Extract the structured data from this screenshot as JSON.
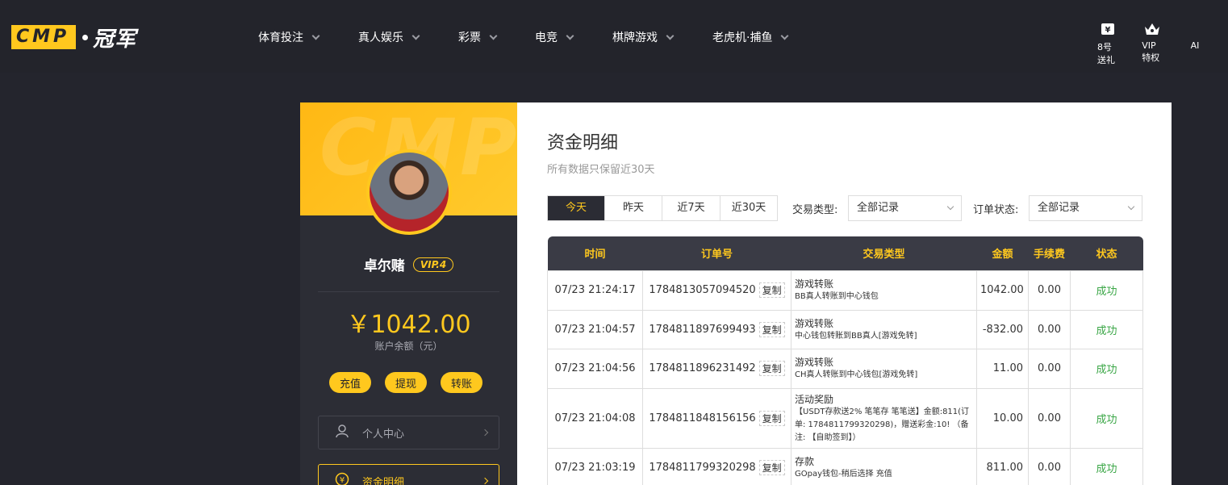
{
  "brand": {
    "logo_text": "CMP",
    "logo_cn": "冠军"
  },
  "nav": [
    {
      "label": "体育投注"
    },
    {
      "label": "真人娱乐"
    },
    {
      "label": "彩票"
    },
    {
      "label": "电竞"
    },
    {
      "label": "棋牌游戏"
    },
    {
      "label": "老虎机·捕鱼"
    }
  ],
  "top_right": [
    {
      "label": "8号送礼",
      "icon": "gift-ticket-icon"
    },
    {
      "label": "VIP特权",
      "icon": "crown-icon"
    },
    {
      "label": "AI",
      "icon": "app-icon"
    }
  ],
  "profile": {
    "header_watermark": "CMP",
    "username": "卓尔赌",
    "vip": "VIP.4",
    "balance": "￥1042.00",
    "balance_label": "账户余额（元）",
    "actions": [
      "充值",
      "提现",
      "转账"
    ],
    "menu": [
      {
        "label": "个人中心",
        "icon": "user-icon",
        "active": false
      },
      {
        "label": "资金明细",
        "icon": "coin-icon",
        "active": true
      }
    ]
  },
  "panel": {
    "title": "资金明细",
    "subtitle": "所有数据只保留近30天",
    "ranges": [
      "今天",
      "昨天",
      "近7天",
      "近30天"
    ],
    "active_range": 0,
    "filter_type_label": "交易类型:",
    "filter_type_value": "全部记录",
    "filter_status_label": "订单状态:",
    "filter_status_value": "全部记录"
  },
  "table": {
    "headers": [
      "时间",
      "订单号",
      "交易类型",
      "金额",
      "手续费",
      "状态"
    ],
    "copy_label": "复制",
    "rows": [
      {
        "time": "07/23 21:24:17",
        "order": "1784813057094520",
        "type": "游戏转账",
        "desc": "BB真人转账到中心钱包",
        "amount": "1042.00",
        "fee": "0.00",
        "status": "成功"
      },
      {
        "time": "07/23 21:04:57",
        "order": "1784811897699493",
        "type": "游戏转账",
        "desc": "中心钱包转账到BB真人[游戏免转]",
        "amount": "-832.00",
        "fee": "0.00",
        "status": "成功"
      },
      {
        "time": "07/23 21:04:56",
        "order": "1784811896231492",
        "type": "游戏转账",
        "desc": "CH真人转账到中心钱包[游戏免转]",
        "amount": "11.00",
        "fee": "0.00",
        "status": "成功"
      },
      {
        "time": "07/23 21:04:08",
        "order": "1784811848156156",
        "type": "活动奖励",
        "desc": "【USDT存款送2% 笔笔存 笔笔送】金额:811(订单: 1784811799320298)，赠送彩金:10! （备注: 【自助签到】）",
        "amount": "10.00",
        "fee": "0.00",
        "status": "成功"
      },
      {
        "time": "07/23 21:03:19",
        "order": "1784811799320298",
        "type": "存款",
        "desc": "GOpay钱包-稍后选择 充值",
        "amount": "811.00",
        "fee": "0.00",
        "status": "成功"
      }
    ]
  }
}
